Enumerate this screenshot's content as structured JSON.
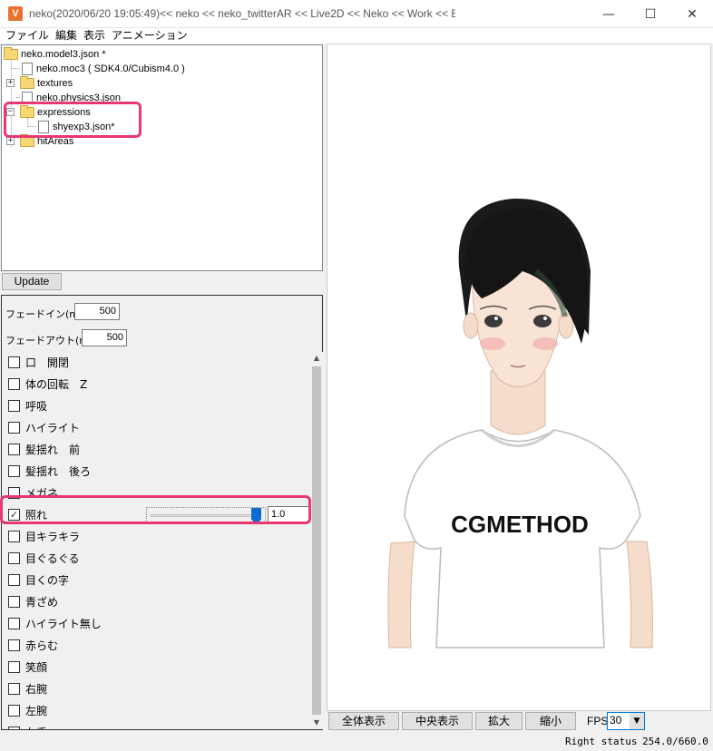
{
  "window": {
    "title": "neko(2020/06/20 19:05:49)<< neko << neko_twitterAR << Live2D << Neko << Work << E:",
    "icon_letter": "V",
    "minimize_glyph": "—",
    "maximize_glyph": "☐",
    "close_glyph": "✕"
  },
  "menu": [
    "ファイル",
    "編集",
    "表示",
    "アニメーション"
  ],
  "tree": {
    "items": [
      {
        "label": "neko.model3.json *",
        "type": "folder"
      },
      {
        "label": "neko.moc3 ( SDK4.0/Cubism4.0 )",
        "type": "file"
      },
      {
        "label": "textures",
        "type": "folder",
        "expander": "+"
      },
      {
        "label": "neko.physics3.json",
        "type": "file"
      },
      {
        "label": "expressions",
        "type": "folder",
        "expander": "−"
      },
      {
        "label": "shyexp3.json*",
        "type": "file"
      },
      {
        "label": "hitAreas",
        "type": "folder",
        "expander": "+"
      }
    ]
  },
  "update_button": "Update",
  "expression": {
    "fade_in_label": "フェードイン(ms)",
    "fade_in_value": "500",
    "fade_out_label": "フェードアウト(ms)",
    "fade_out_value": "500",
    "params": [
      {
        "label": "口　開閉",
        "checked": false
      },
      {
        "label": "体の回転　Z",
        "checked": false
      },
      {
        "label": "呼吸",
        "checked": false
      },
      {
        "label": "ハイライト",
        "checked": false
      },
      {
        "label": "髪揺れ　前",
        "checked": false
      },
      {
        "label": "髪揺れ　後ろ",
        "checked": false
      },
      {
        "label": "メガネ",
        "checked": false
      },
      {
        "label": "照れ",
        "checked": true,
        "value": "1.0",
        "level": 1.0
      },
      {
        "label": "目キラキラ",
        "checked": false
      },
      {
        "label": "目ぐるぐる",
        "checked": false
      },
      {
        "label": "目くの字",
        "checked": false
      },
      {
        "label": "青ざめ",
        "checked": false
      },
      {
        "label": "ハイライト無し",
        "checked": false
      },
      {
        "label": "赤らむ",
        "checked": false
      },
      {
        "label": "笑顔",
        "checked": false
      },
      {
        "label": "右腕",
        "checked": false
      },
      {
        "label": "左腕",
        "checked": false
      },
      {
        "label": "左手",
        "checked": false
      }
    ]
  },
  "viewport": {
    "shirt_text": "CGMETHOD"
  },
  "toolbar": {
    "fit_all": "全体表示",
    "center": "中央表示",
    "zoom_in": "拡大",
    "zoom_out": "縮小",
    "fps_label": "FPS",
    "fps_value": "30"
  },
  "status": {
    "right_status": "Right status",
    "coords": "254.0/660.0"
  },
  "colors": {
    "highlight": "#e8386e",
    "slider_thumb": "#0a6cd1",
    "app_icon": "#e9722d"
  }
}
